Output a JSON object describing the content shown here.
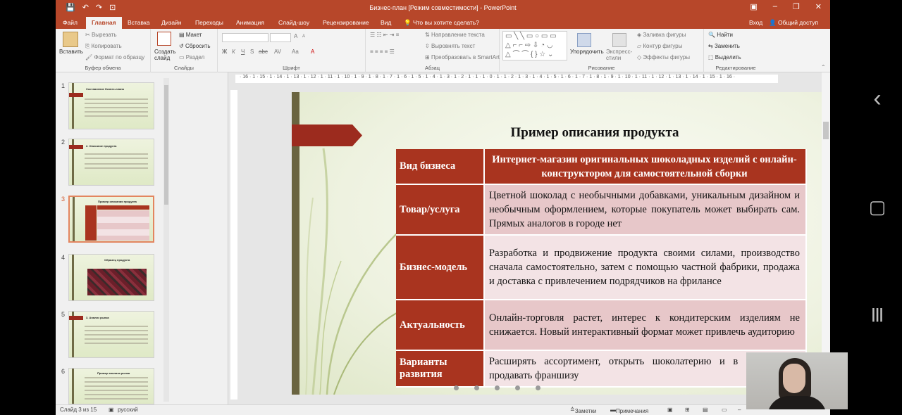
{
  "window": {
    "title": "Бизнес-план [Режим совместимости] - PowerPoint",
    "controls": {
      "ribbon_display": "▣",
      "minimize": "–",
      "restore": "❐",
      "close": "✕"
    }
  },
  "quick_access": {
    "save": "💾",
    "undo": "↶",
    "redo": "↷",
    "start": "⊡"
  },
  "tabs": [
    "Файл",
    "Главная",
    "Вставка",
    "Дизайн",
    "Переходы",
    "Анимация",
    "Слайд-шоу",
    "Рецензирование",
    "Вид"
  ],
  "tell_me": "Что вы хотите сделать?",
  "account": {
    "signin": "Вход",
    "share": "Общий доступ"
  },
  "ribbon": {
    "clipboard": {
      "paste": "Вставить",
      "cut": "Вырезать",
      "copy": "Копировать",
      "format_painter": "Формат по образцу",
      "label": "Буфер обмена"
    },
    "slides": {
      "new_slide": "Создать слайд",
      "layout": "Макет",
      "reset": "Сбросить",
      "section": "Раздел",
      "label": "Слайды"
    },
    "font": {
      "label": "Шрифт",
      "bold": "Ж",
      "italic": "К",
      "underline": "Ч",
      "strike": "S",
      "shadow": "abc",
      "spacing": "AV",
      "case": "Aa",
      "color": "A",
      "grow": "A",
      "shrink": "A"
    },
    "paragraph": {
      "text_direction": "Направление текста",
      "align_text": "Выровнять текст",
      "smartart": "Преобразовать в SmartArt",
      "label": "Абзац"
    },
    "drawing": {
      "arrange": "Упорядочить",
      "quick_styles": "Экспресс-стили",
      "fill": "Заливка фигуры",
      "outline": "Контур фигуры",
      "effects": "Эффекты фигуры",
      "label": "Рисование"
    },
    "editing": {
      "find": "Найти",
      "replace": "Заменить",
      "select": "Выделить",
      "label": "Редактирование"
    }
  },
  "ruler_labels": "· 16 · 1 · 15 · 1 · 14 · 1 · 13 · 1 · 12 · 1 · 11 · 1 · 10 · 1 · 9 · 1 · 8 · 1 · 7 · 1 · 6 · 1 · 5 · 1 · 4 · 1 · 3 · 1 · 2 · 1 · 1 · 1 · 0 · 1 · 1 · 2 · 1 · 3 · 1 · 4 · 1 · 5 · 1 · 6 · 1 · 7 · 1 · 8 · 1 · 9 · 1 · 10 · 1 · 11 · 1 · 12 · 1 · 13 · 1 · 14 · 1 · 15 · 1 · 16 ·",
  "thumbnails": [
    {
      "num": "1",
      "title": "Составление бизнес-плана"
    },
    {
      "num": "2",
      "title": "2. Описание продукта"
    },
    {
      "num": "3",
      "title": "Пример описания продукта"
    },
    {
      "num": "4",
      "title": "Образец продукта"
    },
    {
      "num": "5",
      "title": "3. Анализ рынка"
    },
    {
      "num": "6",
      "title": "Пример анализа рынка"
    }
  ],
  "slide": {
    "title": "Пример описания продукта",
    "rows": [
      {
        "label": "Вид бизнеса",
        "content": "Интернет-магазин оригинальных шоколадных изделий с онлайн-конструктором для самостоятельной сборки"
      },
      {
        "label": "Товар/услуга",
        "content": "Цветной шоколад с необычными добавками, уникальным дизайном и необычным оформлением, которые покупатель может выбирать сам. Прямых аналогов в городе нет"
      },
      {
        "label": "Бизнес-модель",
        "content": "Разработка и продвижение продукта своими силами, производство сначала самостоятельно, затем с помощью частной фабрики, продажа и доставка с привлечением подрядчиков на фрилансе"
      },
      {
        "label": "Актуальность",
        "content": "Онлайн-торговля растет, интерес к кондитерским изделиям не снижается. Новый интерактивный формат может привлечь аудиторию"
      },
      {
        "label": "Варианты развития",
        "content": "Расширять ассортимент, открыть шоколатерию и в перспективе продавать франшизу"
      }
    ]
  },
  "status": {
    "slide_info": "Слайд 3 из 15",
    "language": "русский",
    "notes": "Заметки",
    "comments": "Примечания"
  },
  "android_nav": {
    "back": "‹",
    "home": "▢",
    "recents": "|||"
  }
}
